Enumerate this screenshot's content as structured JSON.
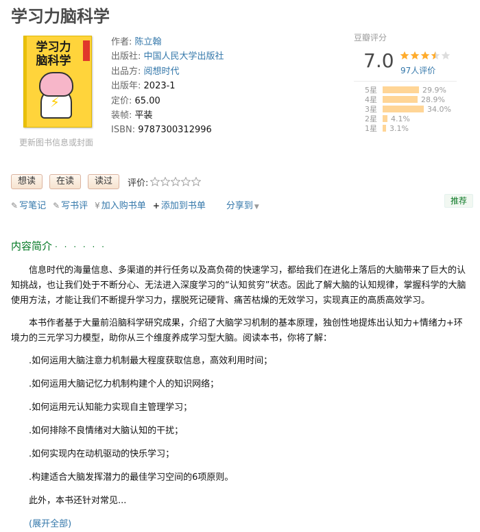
{
  "book": {
    "title": "学习力脑科学",
    "cover_title": "学习力 脑科学",
    "update_link": "更新图书信息或封面",
    "info": [
      {
        "label": "作者:",
        "value": "陈立翰",
        "link": true
      },
      {
        "label": "出版社:",
        "value": "中国人民大学出版社",
        "link": true
      },
      {
        "label": "出品方:",
        "value": "阅想时代",
        "link": true
      },
      {
        "label": "出版年:",
        "value": "2023-1",
        "link": false
      },
      {
        "label": "定价:",
        "value": "65.00",
        "link": false
      },
      {
        "label": "装帧:",
        "value": "平装",
        "link": false
      },
      {
        "label": "ISBN:",
        "value": "9787300312996",
        "link": false
      }
    ]
  },
  "rating": {
    "label": "豆瓣评分",
    "score": "7.0",
    "stars": 3.5,
    "count_text": "97人评价",
    "distribution": [
      {
        "label": "5星",
        "percent": 29.9,
        "text": "29.9%"
      },
      {
        "label": "4星",
        "percent": 28.9,
        "text": "28.9%"
      },
      {
        "label": "3星",
        "percent": 34.0,
        "text": "34.0%"
      },
      {
        "label": "2星",
        "percent": 4.1,
        "text": "4.1%"
      },
      {
        "label": "1星",
        "percent": 3.1,
        "text": "3.1%"
      }
    ],
    "colors": {
      "star": "#ffac2d",
      "star_empty": "#ddd",
      "bar": "#ffd596"
    }
  },
  "actions": {
    "want": "想读",
    "reading": "在读",
    "read": "读过",
    "rate_label": "评价:"
  },
  "tools": {
    "write_note": "写笔记",
    "write_review": "写书评",
    "add_cart": "加入购书单",
    "add_list": "添加到书单",
    "share": "分享到",
    "recommend": "推荐"
  },
  "intro": {
    "heading": "内容简介",
    "dots": "· · · · · ·",
    "paragraphs": [
      "信息时代的海量信息、多渠道的并行任务以及高负荷的快速学习，都给我们在进化上落后的大脑带来了巨大的认知挑战，也让我们处于不断分心、无法进入深度学习的“认知贫穷”状态。因此了解大脑的认知规律，掌握科学的大脑使用方法，才能让我们不断提升学习力，摆脱死记硬背、痛苦枯燥的无效学习，实现真正的高质高效学习。",
      "本书作者基于大量前沿脑科学研究成果，介绍了大脑学习机制的基本原理，独创性地提炼出认知力+情绪力+环境力的三元学习力模型，助你从三个维度养成学习型大脑。阅读本书，你将了解："
    ],
    "items": [
      ".如何运用大脑注意力机制最大程度获取信息，高效利用时间；",
      ".如何运用大脑记忆力机制构建个人的知识网络；",
      ".如何运用元认知能力实现自主管理学习；",
      ".如何排除不良情绪对大脑认知的干扰；",
      ".如何实现内在动机驱动的快乐学习；",
      ".构建适合大脑发挥潜力的最佳学习空间的6项原则。"
    ],
    "truncated": "此外，本书还针对常见...",
    "expand": "(展开全部)"
  }
}
